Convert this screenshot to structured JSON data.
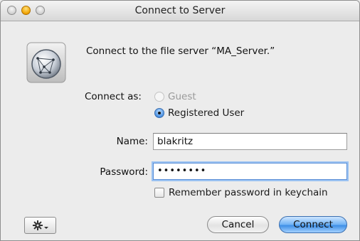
{
  "window": {
    "title": "Connect to Server"
  },
  "icons": {
    "server": "network-server-globe-icon",
    "action": "gear-icon"
  },
  "intro_text": "Connect to the file server “MA_Server.”",
  "connect_as": {
    "label": "Connect as:",
    "options": [
      {
        "label": "Guest",
        "selected": false,
        "enabled": false
      },
      {
        "label": "Registered User",
        "selected": true,
        "enabled": true
      }
    ]
  },
  "name": {
    "label": "Name:",
    "value": "blakritz"
  },
  "password": {
    "label": "Password:",
    "value": "••••••••"
  },
  "remember": {
    "label": "Remember password in keychain",
    "checked": false
  },
  "buttons": {
    "cancel": "Cancel",
    "connect": "Connect"
  },
  "colors": {
    "accent": "#4a90e2",
    "window_bg": "#ececec"
  }
}
